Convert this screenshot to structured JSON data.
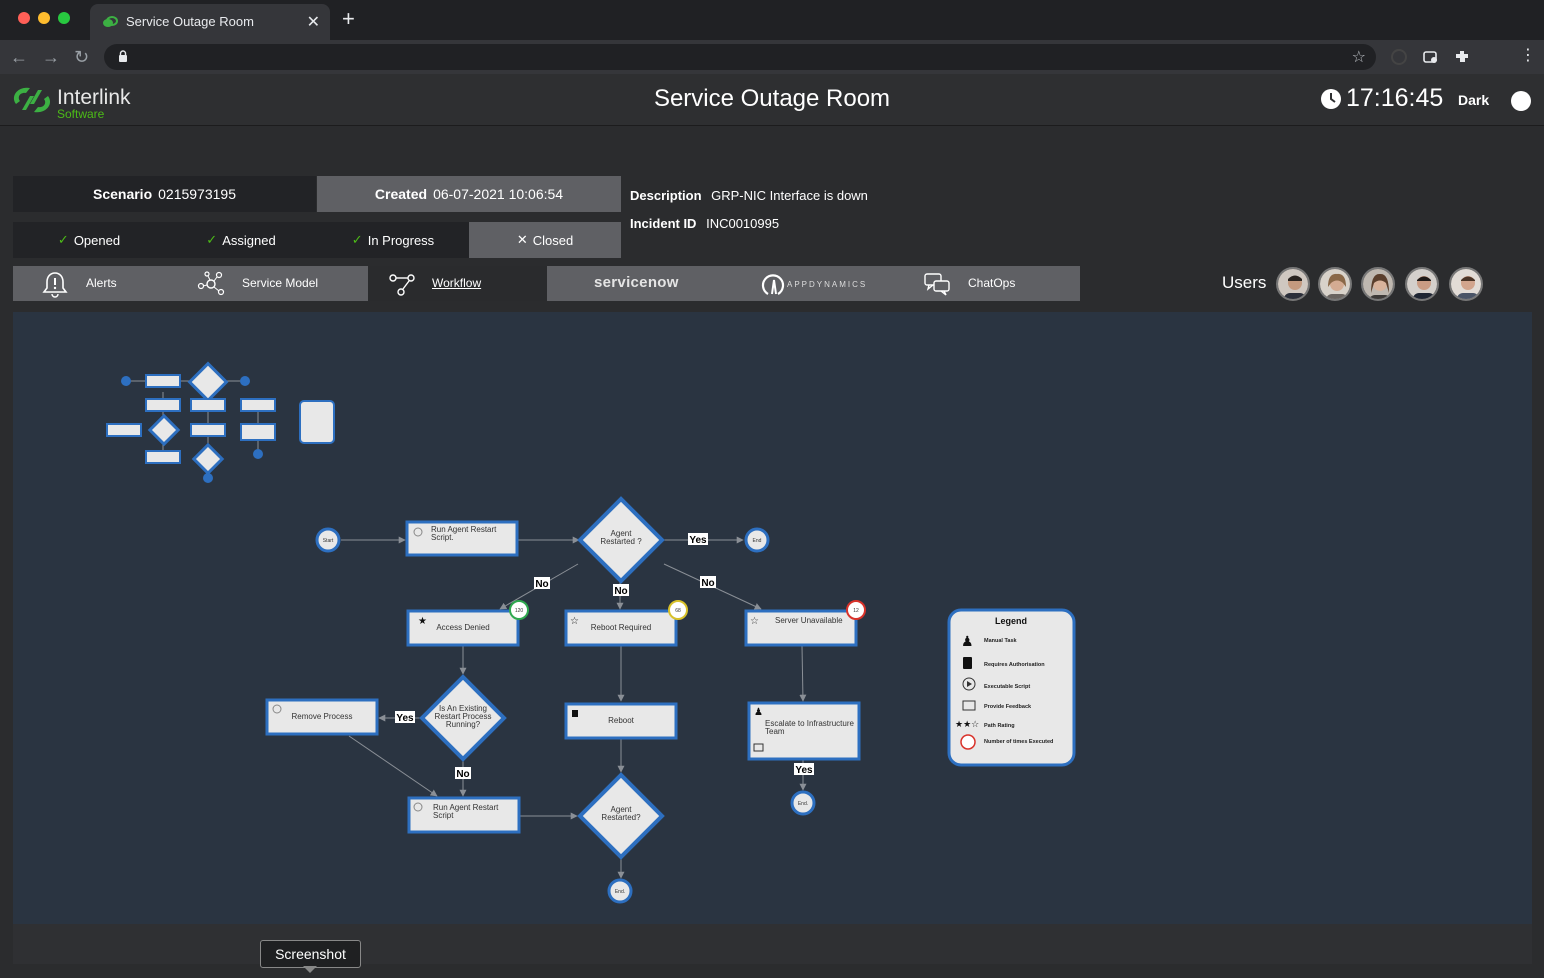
{
  "browser": {
    "tab_title": "Service Outage Room",
    "tab_close": "✕",
    "new_tab": "+"
  },
  "app": {
    "logo_name": "Interlink",
    "logo_sub": "Software",
    "title": "Service Outage Room",
    "clock": "17:16:45",
    "theme_label": "Dark"
  },
  "info": {
    "scenario_label": "Scenario",
    "scenario_value": "0215973195",
    "created_label": "Created",
    "created_value": "06-07-2021 10:06:54",
    "description_label": "Description",
    "description_value": "GRP-NIC Interface is down",
    "incident_label": "Incident ID",
    "incident_value": "INC0010995",
    "statuses": [
      {
        "label": "Opened",
        "mark": "✓"
      },
      {
        "label": "Assigned",
        "mark": "✓"
      },
      {
        "label": "In Progress",
        "mark": "✓"
      },
      {
        "label": "Closed",
        "mark": "✕"
      }
    ]
  },
  "nav": {
    "alerts": "Alerts",
    "service_model": "Service Model",
    "workflow": "Workflow",
    "servicenow": "servicenow",
    "appdynamics": "APPDYNAMICS",
    "chatops": "ChatOps",
    "users_label": "Users"
  },
  "workflow": {
    "start": "Start",
    "end": "End",
    "end_dot": "End.",
    "run_agent_restart_1": "Run Agent Restart Script.",
    "run_agent_restart_2": "Run Agent Restart Script",
    "agent_restarted_1": "Agent Restarted ?",
    "agent_restarted_2": "Agent Restarted?",
    "access_denied": "Access Denied",
    "reboot_required": "Reboot Required",
    "server_unavailable": "Server Unavailable",
    "reboot": "Reboot",
    "escalate": "Escalate to Infrastructure Team",
    "remove_process": "Remove Process",
    "existing_process": "Is An Existing Restart Process Running?",
    "yes": "Yes",
    "no": "No",
    "badge_120": "120",
    "badge_68": "68",
    "badge_12": "12",
    "legend": {
      "title": "Legend",
      "items": [
        "Manual Task",
        "Requires Authorisation",
        "Executable Script",
        "Provide Feedback",
        "Path Rating",
        "Number of times Executed"
      ]
    }
  },
  "tooltip": "Screenshot"
}
